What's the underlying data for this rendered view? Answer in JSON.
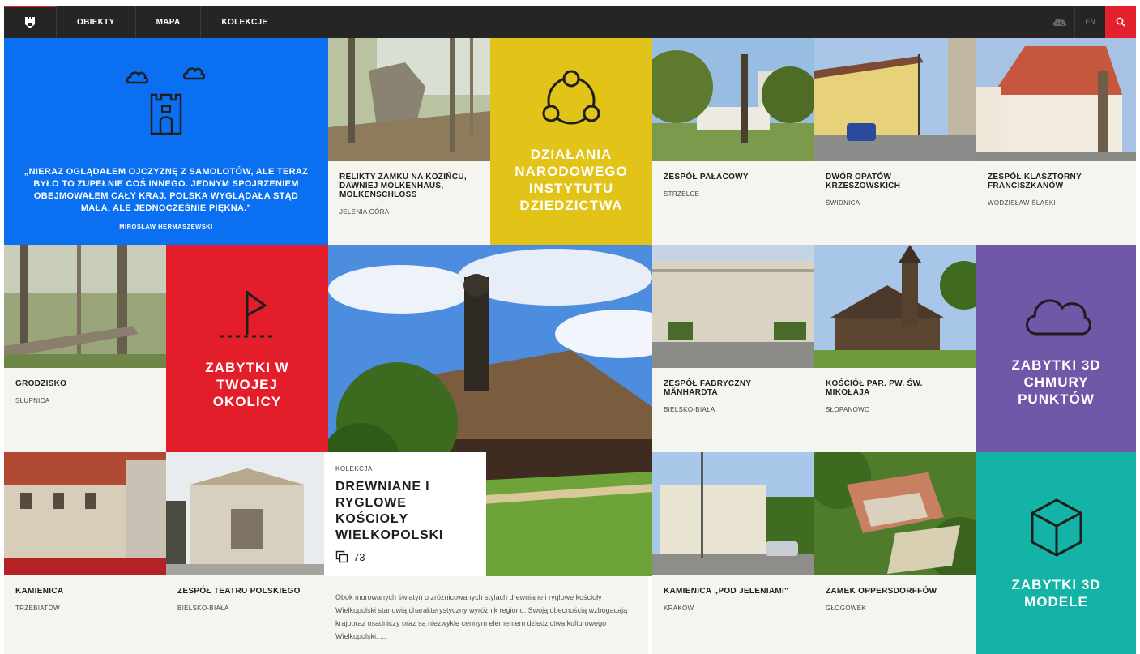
{
  "nav": {
    "links": [
      "OBIEKTY",
      "MAPA",
      "KOLEKCJE"
    ],
    "lang": "EN",
    "icons": {
      "logo": "castle-shield-icon",
      "cloud": "cloud-points-icon",
      "search": "search-icon"
    }
  },
  "quote": {
    "text": "„NIERAZ OGLĄDAŁEM OJCZYZNĘ Z SAMOLOTÓW, ALE TERAZ BYŁO TO ZUPEŁNIE COŚ INNEGO. JEDNYM SPOJRZENIEM OBEJMOWAŁEM CAŁY KRAJ. POLSKA WYGLĄDAŁA STĄD MAŁA, ALE JEDNOCZEŚNIE PIĘKNA.\"",
    "author": "MIROSŁAW HERMASZEWSKI",
    "bg": "#0a6ff0"
  },
  "objects": [
    {
      "title": "RELIKTY ZAMKU NA KOZIŃCU, DAWNIEJ MOLKENHAUS, MOLKENSCHLOSS",
      "location": "JELENIA GÓRA"
    },
    {
      "title": "ZESPÓŁ PAŁACOWY",
      "location": "STRZELCE"
    },
    {
      "title": "DWÓR OPATÓW KRZESZOWSKICH",
      "location": "ŚWIDNICA"
    },
    {
      "title": "ZESPÓŁ KLASZTORNY FRANCISZKANÓW",
      "location": "WODZISŁAW ŚLĄSKI"
    },
    {
      "title": "GRODZISKO",
      "location": "SŁUPNICA"
    },
    {
      "title": "ZESPÓŁ FABRYCZNY MÄNHARDTA",
      "location": "BIELSKO-BIAŁA"
    },
    {
      "title": "KOŚCIÓŁ PAR. PW. ŚW. MIKOŁAJA",
      "location": "SŁOPANOWO"
    },
    {
      "title": "KAMIENICA",
      "location": "TRZEBIATÓW"
    },
    {
      "title": "ZESPÓŁ TEATRU POLSKIEGO",
      "location": "BIELSKO-BIAŁA"
    },
    {
      "title": "KAMIENICA „POD JELENIAMI\"",
      "location": "KRAKÓW"
    },
    {
      "title": "ZAMEK OPPERSDORFFÓW",
      "location": "GŁOGÓWEK"
    }
  ],
  "features": [
    {
      "title": "DZIAŁANIA NARODOWEGO INSTYTUTU DZIEDZICTWA",
      "bg": "#e1c417",
      "icon": "network-circles-icon"
    },
    {
      "title": "ZABYTKI W TWOJEJ OKOLICY",
      "bg": "#e41d2b",
      "icon": "flag-icon"
    },
    {
      "title": "ZABYTKI 3D CHMURY PUNKTÓW",
      "bg": "#7058a8",
      "icon": "cloud-icon"
    },
    {
      "title": "ZABYTKI 3D MODELE",
      "bg": "#13b3a7",
      "icon": "cube-icon"
    }
  ],
  "collection": {
    "kicker": "KOLEKCJA",
    "title": "DREWNIANE I RYGLOWE KOŚCIOŁY WIELKOPOLSKI",
    "count": "73",
    "description": "Obok murowanych świątyń o zróżnicowanych stylach drewniane i ryglowe kościoły Wielkopolski stanowią charakterystyczny wyróżnik regionu. Swoją obecnością wzbogacają krajobraz osadniczy oraz są niezwykle cennym elementem dziedzictwa kulturowego Wielkopolski. ..."
  }
}
